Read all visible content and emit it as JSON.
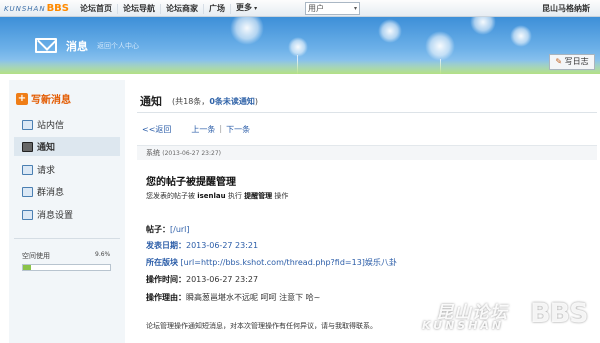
{
  "topbar": {
    "logo_text": "KUNSHAN",
    "logo_accent": "BBS",
    "nav": [
      "论坛首页",
      "论坛导航",
      "论坛商家",
      "广场",
      "更多"
    ],
    "search_select": "用户",
    "username": "昆山马格纳斯"
  },
  "header": {
    "title": "消息",
    "subtitle": "返回个人中心",
    "write_button": "写日志"
  },
  "sidebar": {
    "compose": "写新消息",
    "items": [
      {
        "label": "站内信",
        "active": false
      },
      {
        "label": "通知",
        "active": true
      },
      {
        "label": "请求",
        "active": false
      },
      {
        "label": "群消息",
        "active": false
      },
      {
        "label": "消息设置",
        "active": false
      }
    ],
    "space_label": "空间使用",
    "space_percent": "9.6%",
    "space_fraction": 0.096
  },
  "main": {
    "title": "通知",
    "count_prefix": "(共18条，",
    "unread": "0条未读通知",
    "count_suffix": ")",
    "pager": {
      "back": "<<返回",
      "prev": "上一条",
      "sep": "|",
      "next": "下一条"
    },
    "message": {
      "sender": "系统",
      "time": "(2013-06-27 23:27)",
      "subject": "您的帖子被提醒管理",
      "desc_prefix": "您发表的帖子被",
      "desc_user": "isenlau",
      "desc_mid": "执行",
      "desc_action": "提醒管理",
      "desc_suffix": "操作",
      "fields": [
        {
          "key": "帖子：",
          "value": "[/url]",
          "key_style": "black",
          "value_style": "link"
        },
        {
          "key": "发表日期：",
          "value": "2013-06-27 23:21",
          "key_style": "blue",
          "value_style": "link"
        },
        {
          "key": "所在版块",
          "value": "[url=http://bbs.kshot.com/thread.php?fid=13]娱乐八卦",
          "key_style": "blue",
          "value_style": "link"
        },
        {
          "key": "操作时间：",
          "value": "2013-06-27 23:27",
          "key_style": "black",
          "value_style": "plain"
        },
        {
          "key": "操作理由：",
          "value": "瞬高葱邕堪水不远呢 呵呵 注意下 哈~",
          "key_style": "black",
          "value_style": "plain"
        }
      ],
      "footer": "论坛管理操作通知短消息，对本次管理操作有任何异议，请与我取得联系。"
    }
  },
  "watermark": {
    "cn": "昆山论坛",
    "en": "KUNSHAN",
    "bbs": "BBS"
  },
  "colors": {
    "accent": "#2b5da8",
    "compose": "#e35a00",
    "banner": "#3d8fd8",
    "progress": "#8bc34a"
  }
}
